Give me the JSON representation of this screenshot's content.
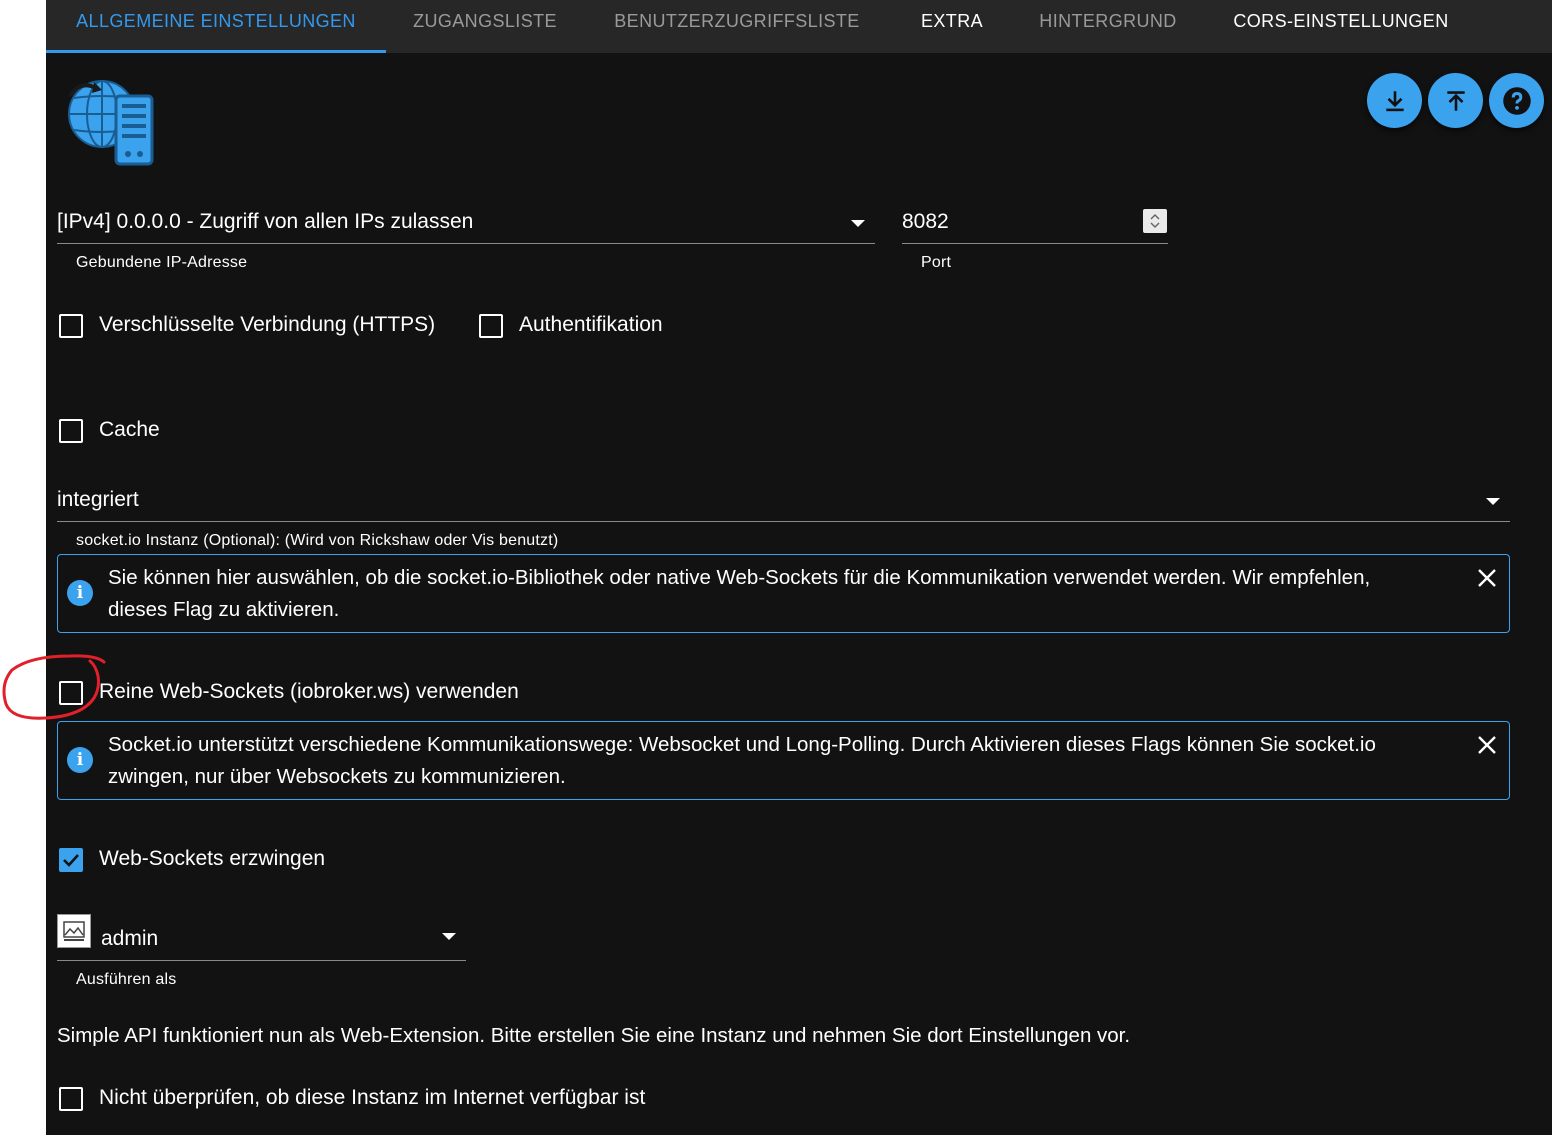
{
  "tabs": [
    {
      "label": "Allgemeine Einstellungen",
      "active": true
    },
    {
      "label": "Zugangsliste",
      "active": false
    },
    {
      "label": "Benutzerzugriffsliste",
      "active": false
    },
    {
      "label": "Extra",
      "active": false
    },
    {
      "label": "Hintergrund",
      "active": false
    },
    {
      "label": "CORS-Einstellungen",
      "active": false
    }
  ],
  "toolbar": {
    "icons": [
      "download-icon",
      "upload-icon",
      "help-icon"
    ]
  },
  "bind_ip": {
    "value": "[IPv4] 0.0.0.0 - Zugriff von allen IPs zulassen",
    "helper": "Gebundene IP-Adresse"
  },
  "port": {
    "value": "8082",
    "helper": "Port"
  },
  "checkboxes": {
    "https": {
      "label": "Verschlüsselte Verbindung (HTTPS)",
      "checked": false
    },
    "auth": {
      "label": "Authentifikation",
      "checked": false
    },
    "cache": {
      "label": "Cache",
      "checked": false
    },
    "pure_ws": {
      "label": "Reine Web-Sockets (iobroker.ws) verwenden",
      "checked": false
    },
    "force_ws": {
      "label": "Web-Sockets erzwingen",
      "checked": true
    },
    "no_check": {
      "label": "Nicht überprüfen, ob diese Instanz im Internet verfügbar ist",
      "checked": false
    }
  },
  "socketio": {
    "value": "integriert",
    "helper": "socket.io Instanz (Optional): (Wird von Rickshaw oder Vis benutzt)"
  },
  "alerts": {
    "first": "Sie können hier auswählen, ob die socket.io-Bibliothek oder native Web-Sockets für die Kommunikation verwendet werden. Wir empfehlen, dieses Flag zu aktivieren.",
    "second": "Socket.io unterstützt verschiedene Kommunikationswege: Websocket und Long-Polling. Durch Aktivieren dieses Flags können Sie socket.io zwingen, nur über Websockets zu kommunizieren."
  },
  "run_as": {
    "value": "admin",
    "helper": "Ausführen als"
  },
  "simple_api_note": "Simple API funktioniert nun als Web-Extension. Bitte erstellen Sie eine Instanz und nehmen Sie dort Einstellungen vor.",
  "colors": {
    "accent": "#3ba2ee",
    "background": "#121212",
    "tabbar": "#272727",
    "annotation": "#e0202a"
  }
}
